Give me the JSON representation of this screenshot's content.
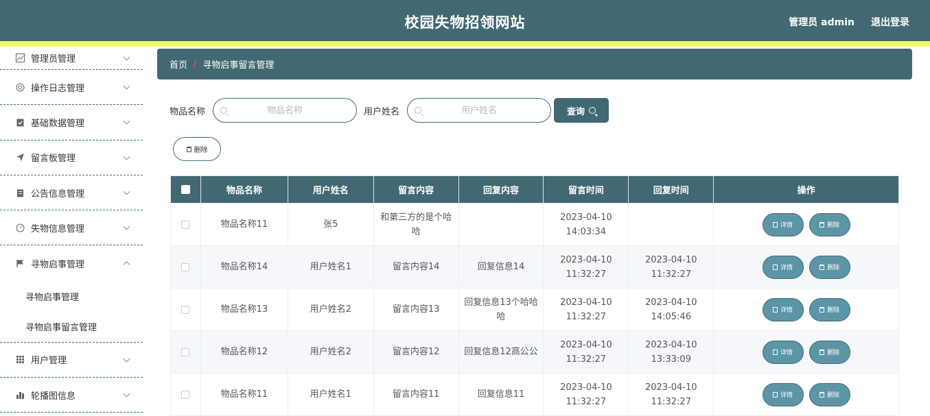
{
  "header": {
    "title": "校园失物招领网站",
    "user": "管理员 admin",
    "logout": "退出登录"
  },
  "sidebar": {
    "items": [
      {
        "label": "管理员管理",
        "icon": "chart-icon"
      },
      {
        "label": "操作日志管理",
        "icon": "lifebuoy-icon"
      },
      {
        "label": "基础数据管理",
        "icon": "clipboard-check-icon"
      },
      {
        "label": "留言板管理",
        "icon": "paper-plane-icon"
      },
      {
        "label": "公告信息管理",
        "icon": "clipboard-icon"
      },
      {
        "label": "失物信息管理",
        "icon": "gauge-icon"
      },
      {
        "label": "寻物启事管理",
        "icon": "flag-icon"
      },
      {
        "label": "用户管理",
        "icon": "grid-icon"
      },
      {
        "label": "轮播图信息",
        "icon": "bar-chart-icon"
      }
    ],
    "subitems": [
      "寻物启事管理",
      "寻物启事留言管理"
    ]
  },
  "breadcrumb": {
    "home": "首页",
    "sep": "/",
    "current": "寻物启事留言管理"
  },
  "search": {
    "item_label": "物品名称",
    "item_placeholder": "物品名称",
    "user_label": "用户姓名",
    "user_placeholder": "用户姓名",
    "query": "查询"
  },
  "actions": {
    "delete": "删除"
  },
  "table": {
    "headers": [
      "物品名称",
      "用户姓名",
      "留言内容",
      "回复内容",
      "留言时间",
      "回复时间",
      "操作"
    ],
    "detail": "详情",
    "delete": "删除",
    "rows": [
      {
        "item": "物品名称11",
        "user": "张5",
        "msg": "和第三方的是个哈哈",
        "reply": "",
        "msg_time": "2023-04-10 14:03:34",
        "reply_time": ""
      },
      {
        "item": "物品名称14",
        "user": "用户姓名1",
        "msg": "留言内容14",
        "reply": "回复信息14",
        "msg_time": "2023-04-10 11:32:27",
        "reply_time": "2023-04-10 11:32:27"
      },
      {
        "item": "物品名称13",
        "user": "用户姓名2",
        "msg": "留言内容13",
        "reply": "回复信息13个哈哈哈",
        "msg_time": "2023-04-10 11:32:27",
        "reply_time": "2023-04-10 14:05:46"
      },
      {
        "item": "物品名称12",
        "user": "用户姓名2",
        "msg": "留言内容12",
        "reply": "回复信息12高公公",
        "msg_time": "2023-04-10 11:32:27",
        "reply_time": "2023-04-10 13:33:09"
      },
      {
        "item": "物品名称11",
        "user": "用户姓名1",
        "msg": "留言内容11",
        "reply": "回复信息11",
        "msg_time": "2023-04-10 11:32:27",
        "reply_time": "2023-04-10 11:32:27"
      }
    ]
  },
  "colors": {
    "primary": "#416873",
    "accent_bar": "#f5f567",
    "op_button": "#5c95a6"
  }
}
